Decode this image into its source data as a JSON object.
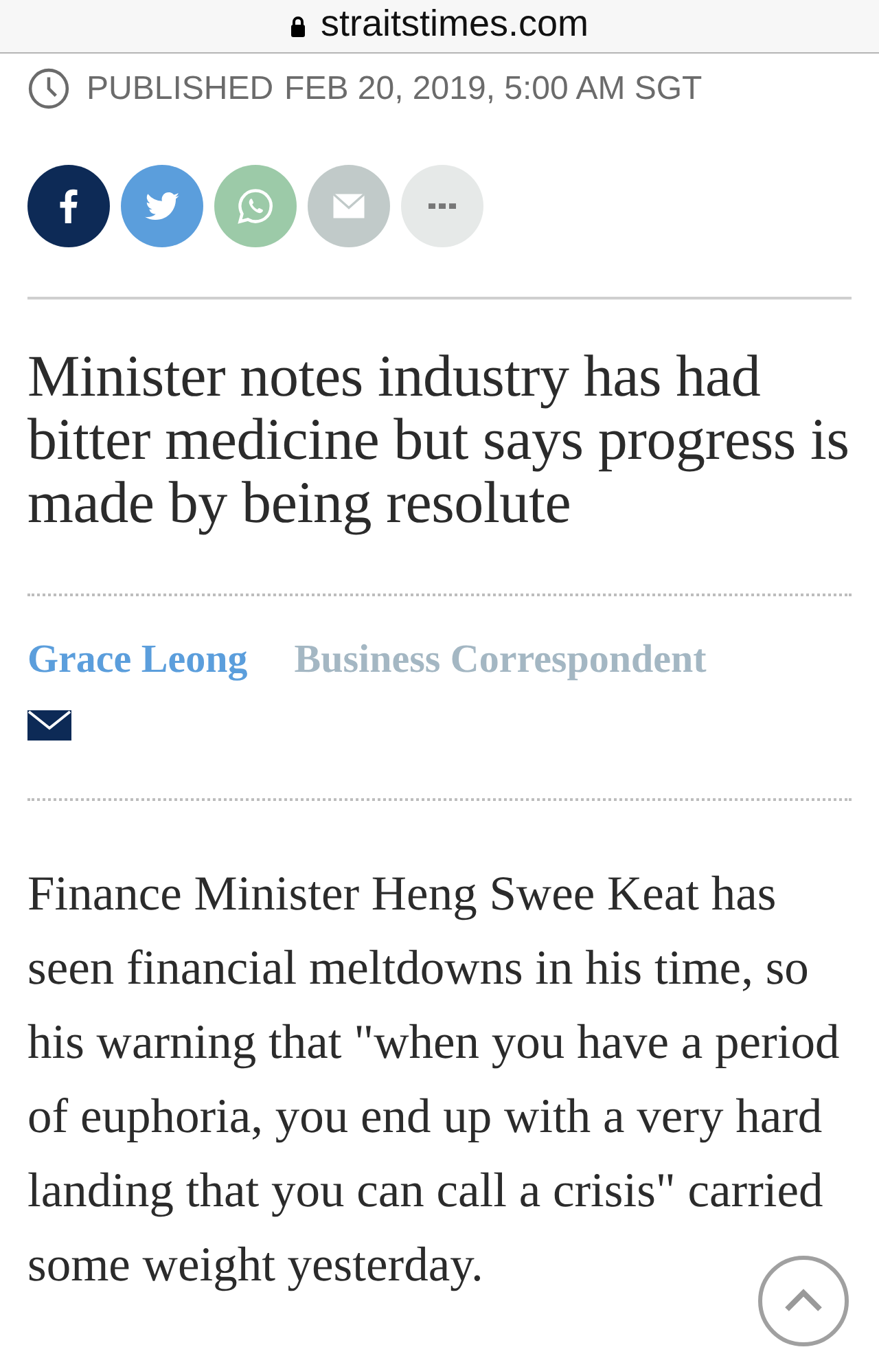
{
  "address_bar": {
    "url": "straitstimes.com",
    "secure": true
  },
  "published": {
    "label": "PUBLISHED",
    "date": "FEB 20, 2019, 5:00 AM SGT"
  },
  "share_buttons": [
    {
      "kind": "facebook",
      "color": "#0d2a56"
    },
    {
      "kind": "twitter",
      "color": "#5b9edc"
    },
    {
      "kind": "whatsapp",
      "color": "#9ccaa8"
    },
    {
      "kind": "email",
      "color": "#c1cac9"
    },
    {
      "kind": "more",
      "color": "#e6e9e8"
    }
  ],
  "headline": "Minister notes industry has had bitter medicine but says progress is made by being resolute",
  "byline": {
    "author": "Grace Leong",
    "role": "Business Correspondent"
  },
  "body": "Finance Minister Heng Swee Keat has seen financial meltdowns in his time, so his warning that \"when you have a period of euphoria, you end up with a very hard landing that you can call a crisis\" carried some weight yesterday."
}
